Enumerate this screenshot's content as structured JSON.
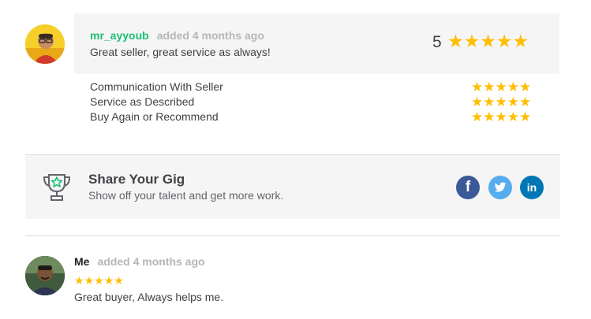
{
  "review": {
    "username": "mr_ayyoub",
    "added": "added 4 months ago",
    "comment": "Great seller, great service as always!",
    "overall_rating": "5",
    "stars": 5,
    "categories": [
      {
        "label": "Communication With Seller",
        "stars": 5
      },
      {
        "label": "Service as Described",
        "stars": 5
      },
      {
        "label": "Buy Again or Recommend",
        "stars": 5
      }
    ]
  },
  "share": {
    "title": "Share Your Gig",
    "subtitle": "Show off your talent and get more work.",
    "icons": [
      "trophy-icon",
      "facebook-icon",
      "twitter-icon",
      "linkedin-icon"
    ],
    "colors": {
      "facebook": "#3b5998",
      "twitter": "#55acee",
      "linkedin": "#0077b5"
    }
  },
  "response": {
    "username": "Me",
    "added": "added 4 months ago",
    "stars": 5,
    "comment": "Great buyer, Always helps me."
  },
  "colors": {
    "accent": "#1dbf73",
    "star": "#ffbe00",
    "muted": "#b5b6ba"
  }
}
